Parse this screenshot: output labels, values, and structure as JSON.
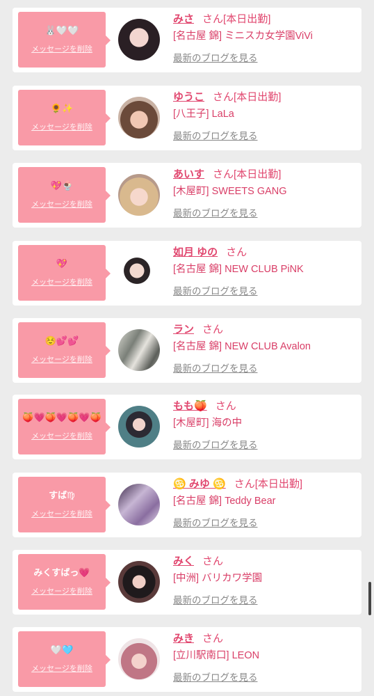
{
  "cards": [
    {
      "msg": "🐰🤍🤍",
      "del": "メッセージを削除",
      "name": "みさ",
      "san": "さん",
      "status": "[本日出勤]",
      "shop": "[名古屋 錦] ミニスカ女学園ViVi",
      "blog": "最新のブログを見る"
    },
    {
      "msg": "🌻✨",
      "del": "メッセージを削除",
      "name": "ゆうこ",
      "san": "さん",
      "status": "[本日出勤]",
      "shop": "[八王子] LaLa",
      "blog": "最新のブログを見る"
    },
    {
      "msg": "💖🍨",
      "del": "メッセージを削除",
      "name": "あいす",
      "san": "さん",
      "status": "[本日出勤]",
      "shop": "[木屋町] SWEETS GANG",
      "blog": "最新のブログを見る"
    },
    {
      "msg": "💖",
      "del": "メッセージを削除",
      "name": "如月 ゆの",
      "san": "さん",
      "status": "",
      "shop": "[名古屋 錦] NEW CLUB PiNK",
      "blog": "最新のブログを見る"
    },
    {
      "msg": "☺️💕💕",
      "del": "メッセージを削除",
      "name": "ラン",
      "san": "さん",
      "status": "",
      "shop": "[名古屋 錦] NEW CLUB Avalon",
      "blog": "最新のブログを見る"
    },
    {
      "msg": "🍑💗🍑💗🍑💗🍑",
      "del": "メッセージを削除",
      "name": "もも🍑",
      "san": "さん",
      "status": "",
      "shop": "[木屋町] 海の中",
      "blog": "最新のブログを見る"
    },
    {
      "msg": "すば♍",
      "del": "メッセージを削除",
      "name": "♋ みゆ ♋",
      "san": "さん",
      "status": "[本日出勤]",
      "shop": "[名古屋 錦] Teddy Bear",
      "blog": "最新のブログを見る"
    },
    {
      "msg": "みくすばっ💗",
      "del": "メッセージを削除",
      "name": "みく",
      "san": "さん",
      "status": "",
      "shop": "[中洲] バリカワ学園",
      "blog": "最新のブログを見る"
    },
    {
      "msg": "🤍🩵",
      "del": "メッセージを削除",
      "name": "みき",
      "san": "さん",
      "status": "",
      "shop": "[立川駅南口] LEON",
      "blog": "最新のブログを見る"
    }
  ],
  "colors": {
    "accent": "#e1476f",
    "message_bg": "#f99aa7",
    "background": "#ececec"
  }
}
